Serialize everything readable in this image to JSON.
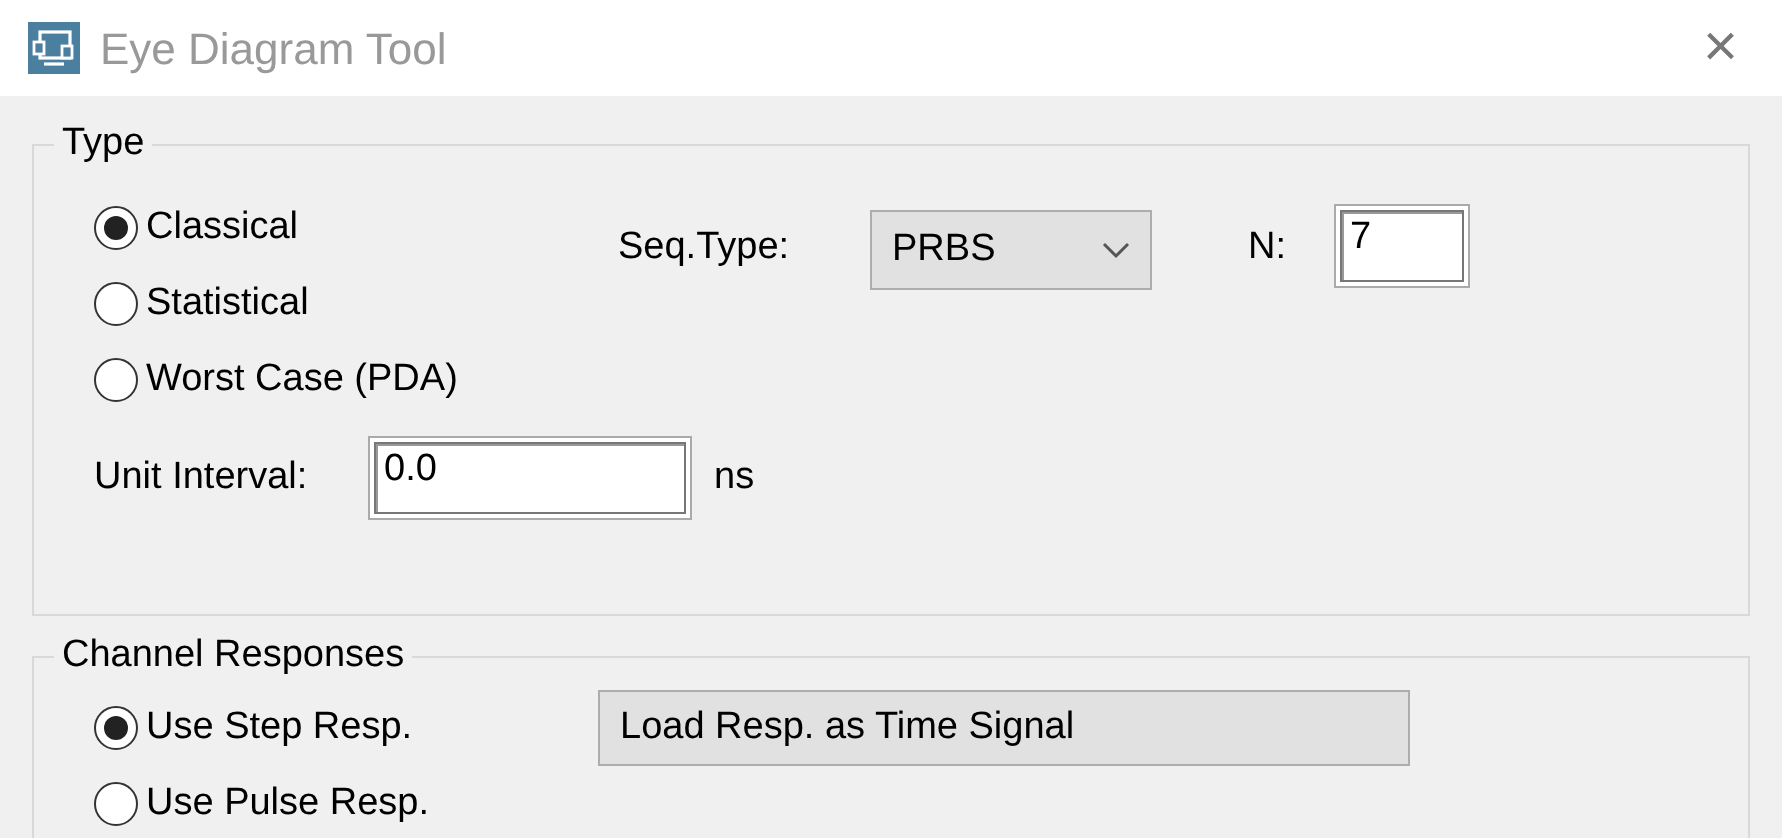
{
  "window": {
    "title": "Eye Diagram Tool",
    "close": "×"
  },
  "type_group": {
    "legend": "Type",
    "options": [
      {
        "label": "Classical",
        "selected": true
      },
      {
        "label": "Statistical",
        "selected": false
      },
      {
        "label": "Worst Case (PDA)",
        "selected": false
      }
    ],
    "seq_type": {
      "label": "Seq.Type:",
      "value": "PRBS"
    },
    "n": {
      "label": "N:",
      "value": "7"
    },
    "unit_interval": {
      "label": "Unit Interval:",
      "value": "0.0",
      "unit": "ns"
    }
  },
  "channel_group": {
    "legend": "Channel Responses",
    "options": [
      {
        "label": "Use Step Resp.",
        "selected": true
      },
      {
        "label": "Use Pulse Resp.",
        "selected": false
      }
    ],
    "load_mode": {
      "value": "Load Resp. as Time Signal"
    }
  }
}
